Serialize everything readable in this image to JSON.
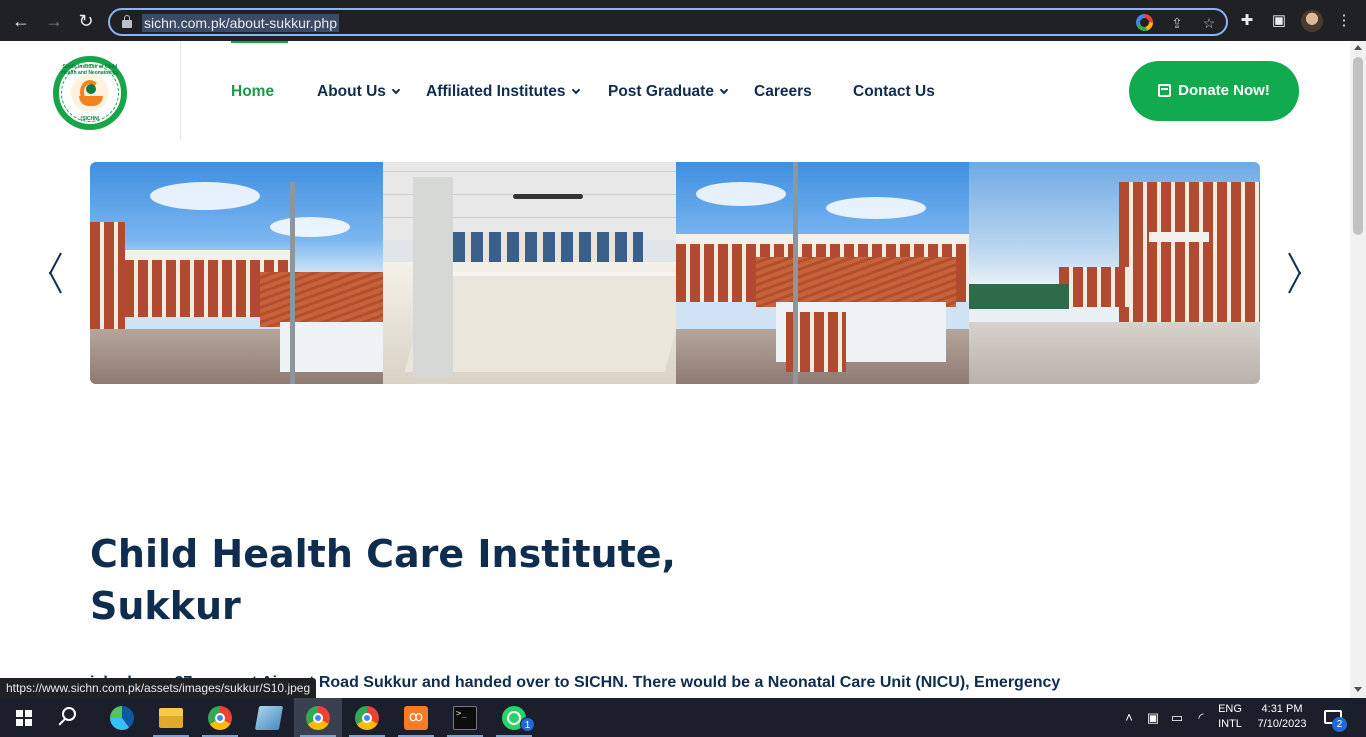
{
  "browser": {
    "url": "sichn.com.pk/about-sukkur.php",
    "status_url": "https://www.sichn.com.pk/assets/images/sukkur/S10.jpeg"
  },
  "site": {
    "logo_text": "Sindh Institute of Child Health and Neonatology",
    "logo_abbr": "(SICHN)",
    "nav": [
      {
        "label": "Home",
        "active": true
      },
      {
        "label": "About Us",
        "dropdown": true
      },
      {
        "label": "Affiliated Institutes",
        "dropdown": true
      },
      {
        "label": "Post Graduate",
        "dropdown": true
      },
      {
        "label": "Careers"
      },
      {
        "label": "Contact Us"
      }
    ],
    "donate_label": "Donate Now!",
    "accent_color": "#11aa4e",
    "text_color": "#0f2d4f"
  },
  "slider": {
    "slides": [
      {
        "alt": "building exterior with light pole"
      },
      {
        "alt": "interior hall with ceiling fans"
      },
      {
        "alt": "building exterior with light pole"
      },
      {
        "alt": "courtyard with brick arcade"
      }
    ]
  },
  "content": {
    "heading_line1": "Child Health Care Institute,",
    "heading_line2": "Sukkur",
    "paragraph": "ished over 27 acres at Airport Road Sukkur and handed over to SICHN. There would be a Neonatal Care Unit (NICU), Emergency"
  },
  "taskbar": {
    "apps": [
      "start",
      "search",
      "edge",
      "file-explorer",
      "chrome",
      "notes",
      "chrome-active",
      "chrome-profile",
      "xampp",
      "terminal",
      "whatsapp"
    ],
    "whatsapp_badge": "1",
    "language_line1": "ENG",
    "language_line2": "INTL",
    "time": "4:31 PM",
    "date": "7/10/2023",
    "notification_count": "2"
  }
}
